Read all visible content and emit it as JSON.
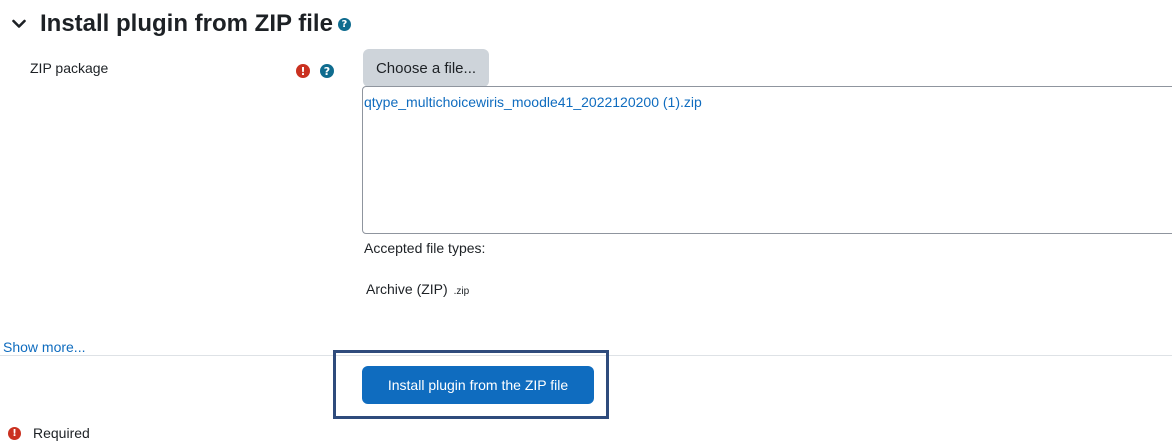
{
  "section": {
    "title": "Install plugin from ZIP file",
    "help_icon": "question-circle-icon",
    "collapse_icon": "chevron-down-icon"
  },
  "form": {
    "zip_label": "ZIP package",
    "required_icon": "exclamation-circle-icon",
    "help_icon": "question-circle-icon",
    "choose_file_label": "Choose a file...",
    "selected_file": "qtype_multichoicewiris_moodle41_2022120200 (1).zip",
    "accepted_types_label": "Accepted file types:",
    "archive_label": "Archive (ZIP)",
    "archive_ext": ".zip",
    "show_more": "Show more...",
    "submit_label": "Install plugin from the ZIP file",
    "required_text": "Required"
  },
  "colors": {
    "accent": "#0f6cbf",
    "required": "#ca3120",
    "highlight_border": "#2f4b7c"
  }
}
